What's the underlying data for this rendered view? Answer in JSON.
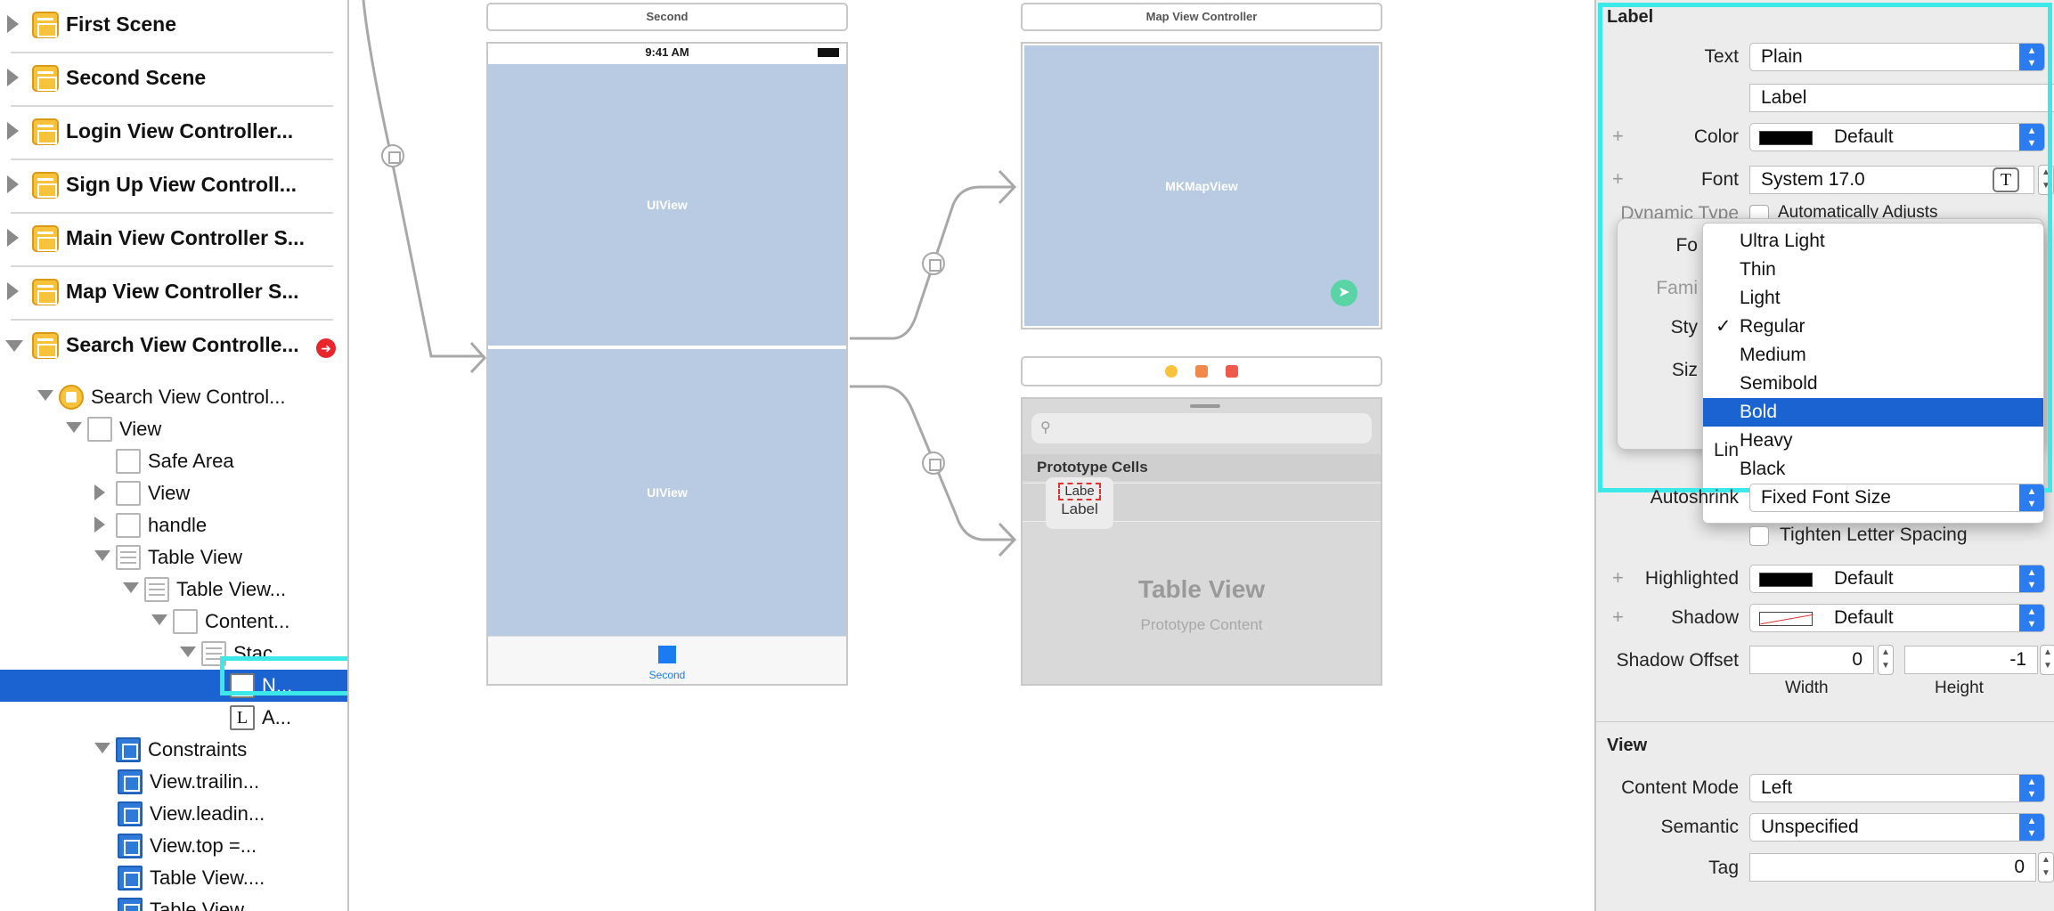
{
  "outline": {
    "scenes": [
      {
        "label": "First Scene",
        "expanded": false,
        "warning": false
      },
      {
        "label": "Second Scene",
        "expanded": false,
        "warning": false
      },
      {
        "label": "Login View Controller...",
        "expanded": false,
        "warning": false
      },
      {
        "label": "Sign Up View Controll...",
        "expanded": false,
        "warning": false
      },
      {
        "label": "Main View Controller S...",
        "expanded": false,
        "warning": false
      },
      {
        "label": "Map View Controller S...",
        "expanded": false,
        "warning": false
      },
      {
        "label": "Search View Controlle...",
        "expanded": true,
        "warning": true
      }
    ],
    "tree": [
      {
        "label": "Search View Control...",
        "icon": "view-controller-icon",
        "disclosure": "open"
      },
      {
        "label": "View",
        "icon": "view-icon",
        "disclosure": "open"
      },
      {
        "label": "Safe Area",
        "icon": "safe-area-icon",
        "disclosure": "none"
      },
      {
        "label": "View",
        "icon": "view-icon",
        "disclosure": "closed"
      },
      {
        "label": "handle",
        "icon": "image-view-icon",
        "disclosure": "closed"
      },
      {
        "label": "Table View",
        "icon": "table-view-icon",
        "disclosure": "open"
      },
      {
        "label": "Table View...",
        "icon": "table-cell-icon",
        "disclosure": "open"
      },
      {
        "label": "Content...",
        "icon": "content-view-icon",
        "disclosure": "open"
      },
      {
        "label": "Stac...",
        "icon": "stack-view-icon",
        "disclosure": "open"
      },
      {
        "label": "N...",
        "icon": "label-icon",
        "glyph": "L",
        "disclosure": "none",
        "selected": true
      },
      {
        "label": "A...",
        "icon": "label-icon",
        "glyph": "L",
        "disclosure": "none"
      },
      {
        "label": "Constraints",
        "icon": "constraints-icon",
        "disclosure": "open"
      },
      {
        "label": "View.trailin...",
        "icon": "constraint-icon",
        "disclosure": "none"
      },
      {
        "label": "View.leadin...",
        "icon": "constraint-icon",
        "disclosure": "none"
      },
      {
        "label": "View.top =...",
        "icon": "constraint-icon",
        "disclosure": "none"
      },
      {
        "label": "Table View....",
        "icon": "constraint-icon",
        "disclosure": "none"
      },
      {
        "label": "Table View....",
        "icon": "constraint-icon",
        "disclosure": "none"
      }
    ]
  },
  "canvas": {
    "second": {
      "title": "Second",
      "time": "9:41 AM",
      "top_view": "UIView",
      "bottom_view": "UIView",
      "tab_label": "Second"
    },
    "map": {
      "title": "Map View Controller",
      "view_label": "MKMapView"
    },
    "search": {
      "prototype_header": "Prototype Cells",
      "cell_label_top": "Labe",
      "cell_label_bottom": "Label",
      "table_title": "Table View",
      "table_subtitle": "Prototype Content"
    }
  },
  "inspector": {
    "label_section": {
      "title": "Label",
      "text_label": "Text",
      "text_value": "Plain",
      "text_content": "Label",
      "color_label": "Color",
      "color_value": "Default",
      "font_label": "Font",
      "font_value": "System 17.0",
      "dynamic_type_label": "Dynamic Type",
      "dynamic_type_value": "Automatically Adjusts"
    },
    "font_popover": {
      "font_label": "Fo",
      "family_label": "Fami",
      "style_label": "Sty",
      "size_label": "Siz",
      "lines_label": "Lin"
    },
    "style_menu": {
      "items": [
        "Ultra Light",
        "Thin",
        "Light",
        "Regular",
        "Medium",
        "Semibold",
        "Bold",
        "Heavy",
        "Black"
      ],
      "checked": "Regular",
      "highlighted": "Bold"
    },
    "lower": {
      "autoshrink_label": "Autoshrink",
      "autoshrink_value": "Fixed Font Size",
      "tighten_label": "Tighten Letter Spacing",
      "highlighted_label": "Highlighted",
      "highlighted_value": "Default",
      "shadow_label": "Shadow",
      "shadow_value": "Default",
      "shadow_offset_label": "Shadow Offset",
      "shadow_offset_width": "0",
      "shadow_offset_height": "-1",
      "width_label": "Width",
      "height_label": "Height"
    },
    "view_section": {
      "title": "View",
      "content_mode_label": "Content Mode",
      "content_mode_value": "Left",
      "semantic_label": "Semantic",
      "semantic_value": "Unspecified",
      "tag_label": "Tag",
      "tag_value": "0"
    }
  },
  "colors": {
    "accent": "#1a63d1",
    "highlight_outline": "#3ce8e8",
    "scene_icon": "#f7c23c",
    "view_fill": "#b8cbe2",
    "popup_arrows": "#2a7cf0",
    "warning": "#e8262c"
  }
}
